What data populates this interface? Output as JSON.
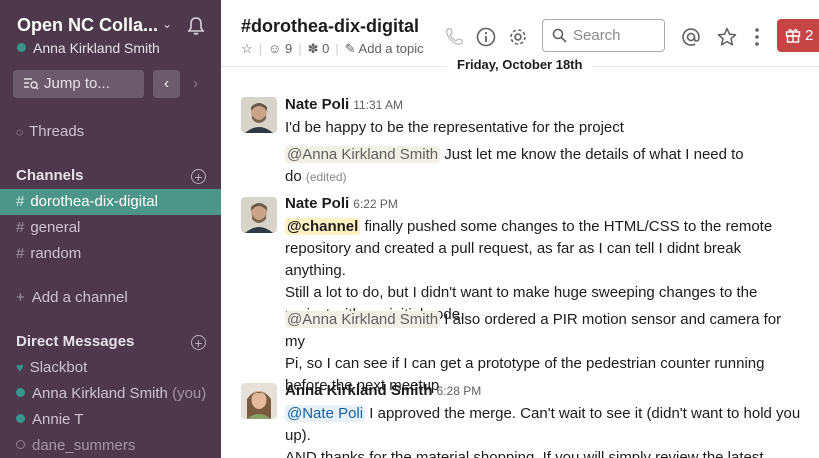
{
  "workspace": {
    "name": "Open NC Colla...",
    "user": "Anna Kirkland Smith",
    "jump_label": "Jump to..."
  },
  "sidebar": {
    "threads_label": "Threads",
    "channels_header": "Channels",
    "channels": [
      {
        "label": "dorothea-dix-digital",
        "active": true
      },
      {
        "label": "general",
        "active": false
      },
      {
        "label": "random",
        "active": false
      }
    ],
    "add_channel_label": "Add a channel",
    "dm_header": "Direct Messages",
    "dms": [
      {
        "label": "Slackbot",
        "suffix": ""
      },
      {
        "label": "Anna Kirkland Smith",
        "suffix": "(you)"
      },
      {
        "label": "Annie T",
        "suffix": ""
      },
      {
        "label": "dane_summers",
        "suffix": ""
      }
    ]
  },
  "header": {
    "channel_name": "#dorothea-dix-digital",
    "members_count": "9",
    "pinned_count": "0",
    "topic_placeholder": "Add a topic",
    "search_placeholder": "Search",
    "gift_count": "2"
  },
  "date_divider": "Friday, October 18th",
  "messages": [
    {
      "author": "Nate Poli",
      "time": "11:31 AM",
      "text": "I'd be happy to be the representative for the project",
      "followup_mention": "@Anna Kirkland Smith",
      "followup_line1": " Just let me know the details of what I need to",
      "followup_line2": "do",
      "edited": "(edited)"
    },
    {
      "author": "Nate Poli",
      "time": "6:22 PM",
      "mention": "@channel",
      "lines": [
        " finally pushed some changes to the HTML/CSS to the remote",
        "repository and created a pull request, as far as I can tell I didnt break anything.",
        " Still a lot to do, but I didn't want to make huge sweeping changes to the",
        "project with my initial code."
      ],
      "followup_mention": "@Anna Kirkland Smith",
      "followup_lines": [
        " I also ordered a PIR motion sensor and camera for my",
        "Pi, so I can see if I can get a prototype of the pedestrian counter running",
        "before the next meetup"
      ]
    },
    {
      "author": "Anna Kirkland Smith",
      "time": "6:28 PM",
      "mention": "@Nate Poli",
      "line1": " I approved the merge. Can't wait to see it (didn't want to hold you",
      "line2": "up).",
      "line3": "AND thanks for the material shopping. If you will simply review the latest"
    }
  ]
}
